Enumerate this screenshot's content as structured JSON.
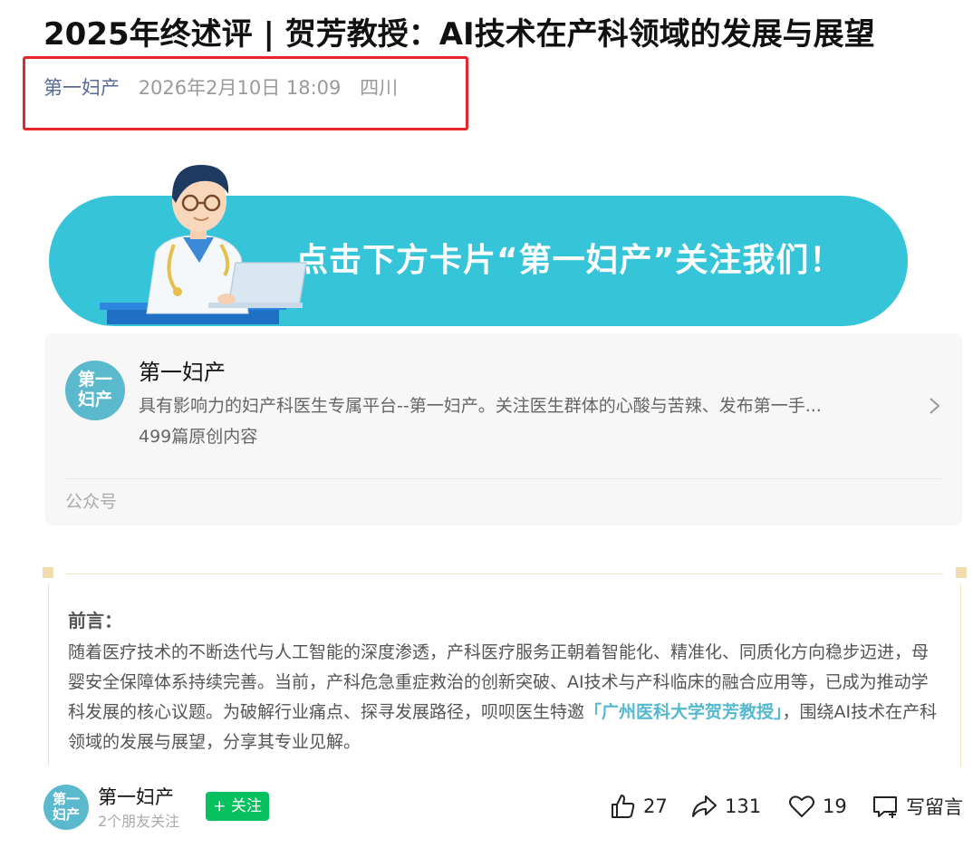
{
  "article": {
    "title": "2025年终述评 | 贺芳教授：AI技术在产科领域的发展与展望",
    "author": "第一妇产",
    "date": "2026年2月10日 18:09",
    "location": "四川"
  },
  "banner": {
    "text": "点击下方卡片“第一妇产”关注我们！"
  },
  "account_card": {
    "avatar_text_line1": "第一",
    "avatar_text_line2": "妇产",
    "name": "第一妇产",
    "description": "具有影响力的妇产科医生专属平台--第一妇产。关注医生群体的心酸与苦辣、发布第一手...",
    "original_count": "499篇原创内容",
    "type_label": "公众号"
  },
  "preface": {
    "label": "前言：",
    "body_part1": "随着医疗技术的不断迭代与人工智能的深度渗透，产科医疗服务正朝着智能化、精准化、同质化方向稳步迈进，母婴安全保障体系持续完善。当前，产科危急重症救治的创新突破、AI技术与产科临床的融合应用等，已成为推动学科发展的核心议题。为破解行业痛点、探寻发展路径，呗呗医生特邀",
    "highlight": "「广州医科大学贺芳教授」",
    "body_part2": "，围绕AI技术在产科领域的发展与展望，分享其专业见解。"
  },
  "bottom_bar": {
    "avatar_text_line1": "第一",
    "avatar_text_line2": "妇产",
    "account_name": "第一妇产",
    "friends_following": "2个朋友关注",
    "follow_label": "+ 关注",
    "likes": "27",
    "shares": "131",
    "favorites": "19",
    "comment_label": "写留言"
  },
  "colors": {
    "author_link": "#576b95",
    "highlight_box": "#e8262a",
    "banner_bg": "#36c4d8",
    "avatar_bg": "#5ab9cc",
    "follow_button": "#07c160",
    "preface_highlight": "#55b8cf"
  },
  "icons": [
    "chevron-right-icon",
    "thumb-up-icon",
    "share-icon",
    "heart-icon",
    "comment-icon"
  ]
}
